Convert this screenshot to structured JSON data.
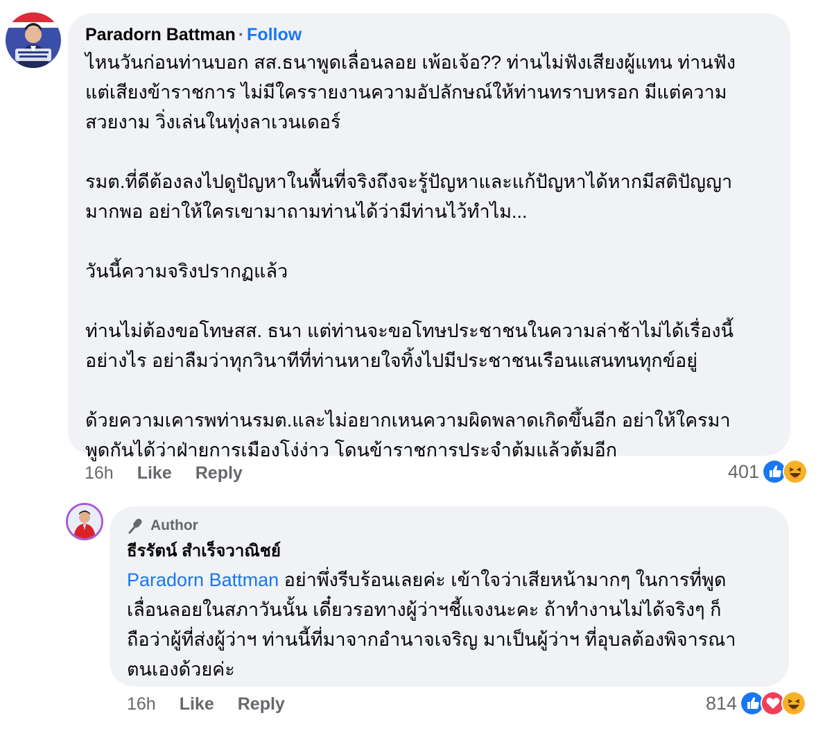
{
  "comment1": {
    "author": "Paradorn Battman",
    "follow_label": "Follow",
    "separator": "·",
    "paragraphs": [
      [
        "ไหนวันก่อนท่านบอก สส.ธนาพูดเลื่อนลอย เพ้อเจ้อ?? ท่านไม่ฟังเสียงผู้แทน ท่านฟัง",
        "แต่เสียงข้าราชการ ไม่มีใครรายงานความอัปลักษณ์ให้ท่านทราบหรอก มีแต่ความ",
        "สวยงาม วิ่งเล่นในทุ่งลาเวนเดอร์"
      ],
      [
        "รมต.ที่ดีต้องลงไปดูปัญหาในพื้นที่จริงถึงจะรู้ปัญหาและแก้ปัญหาได้หากมีสติปัญญา",
        "มากพอ อย่าให้ใครเขามาถามท่านได้ว่ามีท่านไว้ทำไม..."
      ],
      [
        "วันนี้ความจริงปรากฏแล้ว"
      ],
      [
        "ท่านไม่ต้องขอโทษสส. ธนา  แต่ท่านจะขอโทษประชาชนในความล่าช้าไม่ได้เรื่องนี้",
        "อย่างไร  อย่าลืมว่าทุกวินาทีที่ท่านหายใจทิ้งไปมีประชาชนเรือนแสนทนทุกข์อยู่"
      ],
      [
        "ด้วยความเคารพท่านรมต.และไม่อยากเหนความผิดพลาดเกิดขึ้นอีก อย่าให้ใครมา",
        "พูดกันได้ว่าฝ่ายการเมืองโง่ง่าว โดนข้าราชการประจำต้มแล้วต้มอีก"
      ]
    ],
    "time": "16h",
    "like_label": "Like",
    "reply_label": "Reply",
    "reaction_count": "401",
    "reactions": [
      "like-icon",
      "haha-icon"
    ]
  },
  "reply1": {
    "badge_label": "Author",
    "author": "ธีรรัตน์ สำเร็จวาณิชย์",
    "mention": "Paradorn Battman",
    "lines": [
      " อย่าพึ่งรีบร้อนเลยค่ะ เข้าใจว่าเสียหน้ามากๆ ในการที่พูด",
      "เลื่อนลอยในสภาวันนั้น เดี๋ยวรอทางผู้ว่าฯชี้แจงนะคะ ถ้าทำงานไม่ได้จริงๆ ก็",
      "ถือว่าผู้ที่ส่งผู้ว่าฯ ท่านนี้ที่มาจากอำนาจเจริญ มาเป็นผู้ว่าฯ ที่อุบลต้องพิจารณา",
      "ตนเองด้วยค่ะ"
    ],
    "time": "16h",
    "like_label": "Like",
    "reply_label": "Reply",
    "reaction_count": "814",
    "reactions": [
      "like-icon",
      "love-icon",
      "haha-icon"
    ]
  },
  "colors": {
    "bubble": "#f0f2f5",
    "link": "#1877f2",
    "meta": "#65676b",
    "like": "#1877f2",
    "love": "#f33e58",
    "haha": "#f7b125"
  }
}
